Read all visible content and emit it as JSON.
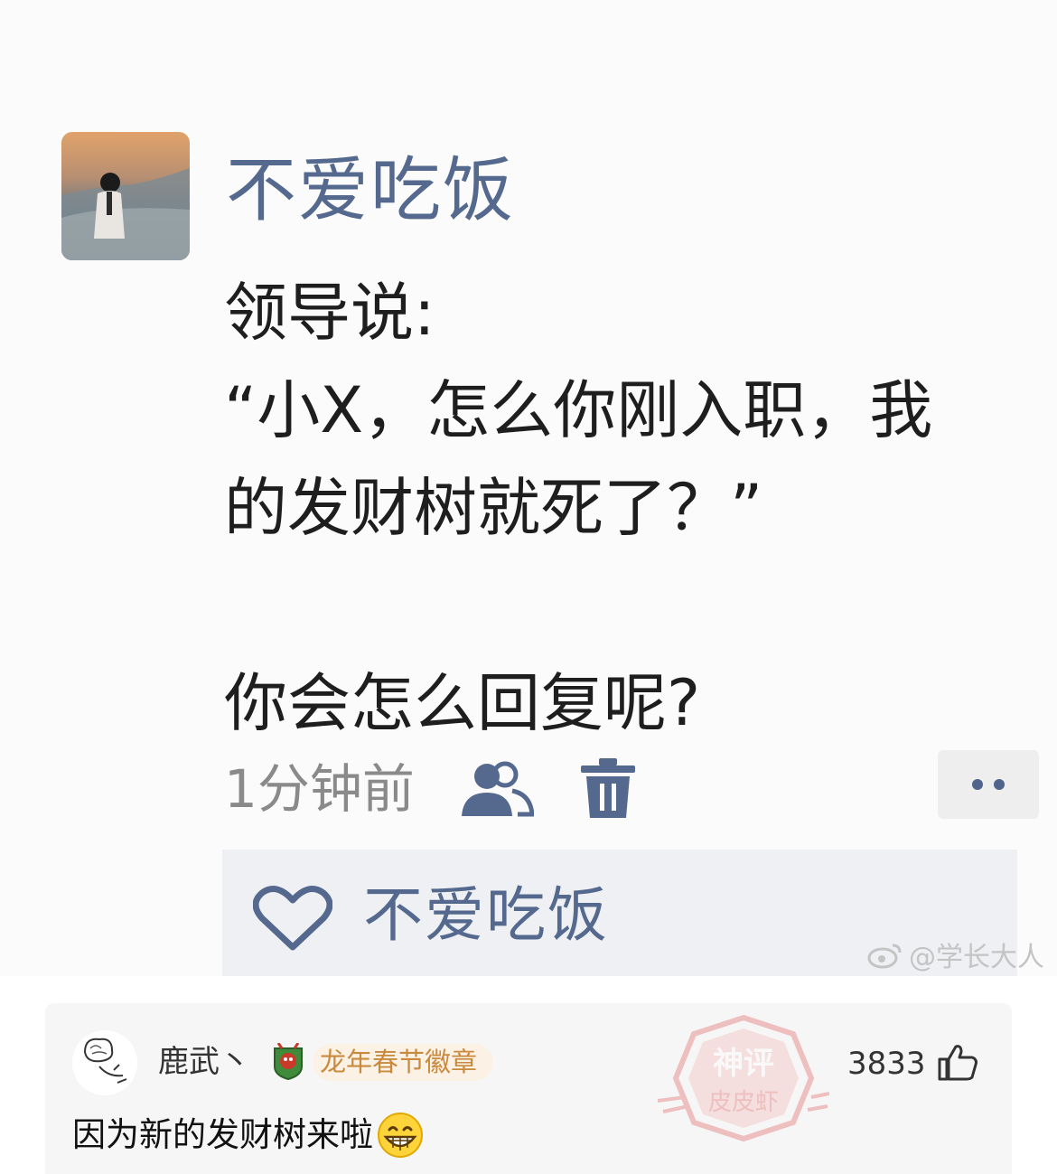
{
  "post": {
    "username": "不爱吃饭",
    "lines": [
      "领导说:",
      "“小X，怎么你刚入职，我",
      "的发财树就死了？”",
      "",
      "你会怎么回复呢?"
    ],
    "timestamp": "1分钟前",
    "liker": "不爱吃饭",
    "watermark": "@学长大人",
    "accent_color": "#55698f"
  },
  "comment": {
    "author": "鹿武丶",
    "badge": "龙年春节徽章",
    "like_count": "3833",
    "text": "因为新的发财树来啦",
    "stamp_text": [
      "神评",
      "皮皮虾"
    ]
  }
}
